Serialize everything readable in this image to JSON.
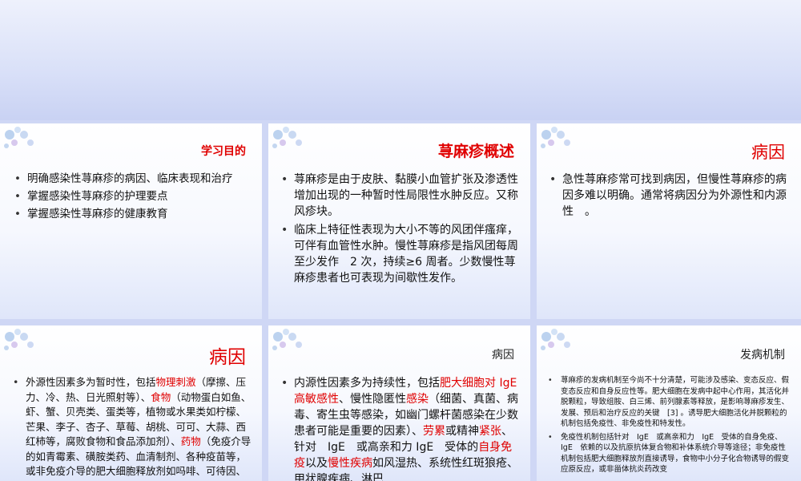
{
  "slides": [
    {
      "title": "学习目的",
      "bullets": [
        "明确感染性荨麻疹的病因、临床表现和治疗",
        "掌握感染性荨麻疹的护理要点",
        "掌握感染性荨麻疹的健康教育"
      ]
    },
    {
      "title": "荨麻疹概述",
      "bullets": [
        "荨麻疹是由于皮肤、黏膜小血管扩张及渗透性增加出现的一种暂时性局限性水肿反应。又称风疹块。",
        "临床上特征性表现为大小不等的风团伴瘙痒，可伴有血管性水肿。慢性荨麻疹是指风团每周至少发作　2 次，持续≥6 周者。少数慢性荨麻疹患者也可表现为间歇性发作。"
      ]
    },
    {
      "title": "病因",
      "bullets": [
        "急性荨麻疹常可找到病因，但慢性荨麻疹的病因多难以明确。通常将病因分为外源性和内源性　。"
      ]
    },
    {
      "title": "病因",
      "b1": {
        "t1": "外源性因素多为暂时性，包括",
        "h1": "物理刺激",
        "t2": "（摩擦、压力、冷、热、日光照射等）、",
        "h2": "食物",
        "t3": "（动物蛋白如鱼、虾、蟹、贝壳类、蛋类等，植物或水果类如柠檬、芒果、李子、杏子、草莓、胡桃、可可、大蒜、西红柿等，腐败食物和食品添加剂）、",
        "h3": "药物",
        "t4": "（免疫介导的如青霉素、磺胺类药、血清制剂、各种疫苗等，或非免疫介导的肥大细胞释放剂如吗啡、可待因、阿司匹林等）、"
      }
    },
    {
      "title": "病因",
      "b1": {
        "t1": "内源性因素多为持续性，包括",
        "h1": "肥大细胞对 IgE 高敏感性",
        "t2": "、慢性隐匿性",
        "h2": "感染",
        "t3": "（细菌、真菌、病毒、寄生虫等感染，如幽门螺杆菌感染在少数患者可能是重要的因素）、",
        "h3": "劳累",
        "t4": "或精神",
        "h4": "紧张",
        "t5": "、针对　IgE　或高亲和力 IgE　受体的",
        "h5": "自身免疫",
        "t6": "以及",
        "h6": "慢性疾病",
        "t7": "如风湿热、系统性红斑狼疮、甲状腺疾病、淋巴"
      }
    },
    {
      "title": "发病机制",
      "bullets": [
        "荨麻疹的发病机制至今尚不十分清楚，可能涉及感染、变态反应、假变态反应和自身反应性等。肥大细胞在发病中起中心作用，其活化并脱颗粒，导致组胺、白三烯、前列腺素等释放，是影响荨麻疹发生、发展、预后和治疗反应的关键　[3] 。诱导肥大细胞活化并脱颗粒的机制包括免疫性、非免疫性和特发性。",
        "免疫性机制包括针对　IgE　或高亲和力　IgE　受体的自身免疫、IgE　依赖的以及抗原抗体复合物和补体系统介导等途径；非免疫性机制包括肥大细胞释放剂直接诱导，食物中小分子化合物诱导的假变应原反应，或非甾体抗炎药改变"
      ]
    }
  ],
  "colors": {
    "accent_red": "#e00000",
    "background": "#cfd7f5"
  }
}
